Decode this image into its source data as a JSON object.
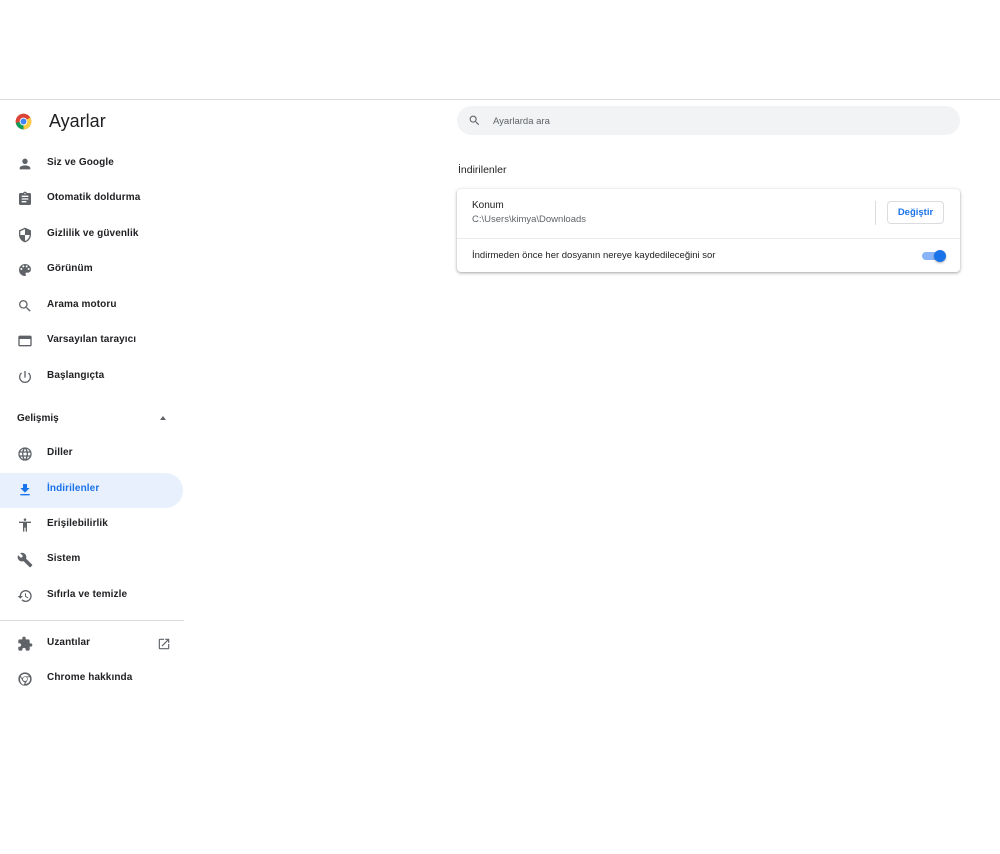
{
  "app": {
    "title": "Ayarlar"
  },
  "search": {
    "placeholder": "Ayarlarda ara"
  },
  "sidebar": {
    "items": [
      {
        "label": "Siz ve Google",
        "icon": "person-icon"
      },
      {
        "label": "Otomatik doldurma",
        "icon": "clipboard-icon"
      },
      {
        "label": "Gizlilik ve güvenlik",
        "icon": "shield-icon"
      },
      {
        "label": "Görünüm",
        "icon": "palette-icon"
      },
      {
        "label": "Arama motoru",
        "icon": "search-icon"
      },
      {
        "label": "Varsayılan tarayıcı",
        "icon": "browser-window-icon"
      },
      {
        "label": "Başlangıçta",
        "icon": "power-icon"
      }
    ],
    "advanced": {
      "label": "Gelişmiş",
      "expanded": true,
      "items": [
        {
          "label": "Diller",
          "icon": "globe-icon"
        },
        {
          "label": "İndirilenler",
          "icon": "download-icon",
          "active": true
        },
        {
          "label": "Erişilebilirlik",
          "icon": "accessibility-icon"
        },
        {
          "label": "Sistem",
          "icon": "wrench-icon"
        },
        {
          "label": "Sıfırla ve temizle",
          "icon": "restore-icon"
        }
      ]
    },
    "extensions": {
      "label": "Uzantılar",
      "icon": "puzzle-icon",
      "external_icon": "open-in-new-icon"
    },
    "about": {
      "label": "Chrome hakkında",
      "icon": "chrome-icon"
    }
  },
  "main": {
    "section_title": "İndirilenler",
    "location": {
      "label": "Konum",
      "path": "C:\\Users\\kimya\\Downloads",
      "button_label": "Değiştir"
    },
    "ask_before_download": {
      "label": "İndirmeden önce her dosyanın nereye kaydedileceğini sor",
      "enabled": true
    }
  },
  "colors": {
    "accent": "#1a73e8",
    "active_bg": "#e8f0fe",
    "search_bg": "#f1f3f4",
    "toggle_track": "#8ab4f8"
  }
}
